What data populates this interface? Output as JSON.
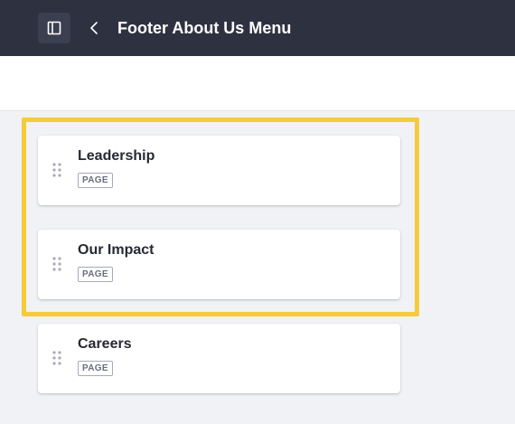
{
  "header": {
    "title": "Footer About Us Menu",
    "panel_toggle_icon": "sidebar-panel-icon",
    "back_icon": "chevron-left-icon"
  },
  "menu_items": [
    {
      "title": "Leadership",
      "type": "PAGE",
      "selected": true
    },
    {
      "title": "Our Impact",
      "type": "PAGE",
      "selected": true
    },
    {
      "title": "Careers",
      "type": "PAGE",
      "selected": false
    }
  ],
  "colors": {
    "header_bg": "#2e3140",
    "highlight": "#f6cb3b",
    "page_bg": "#f1f2f5"
  }
}
